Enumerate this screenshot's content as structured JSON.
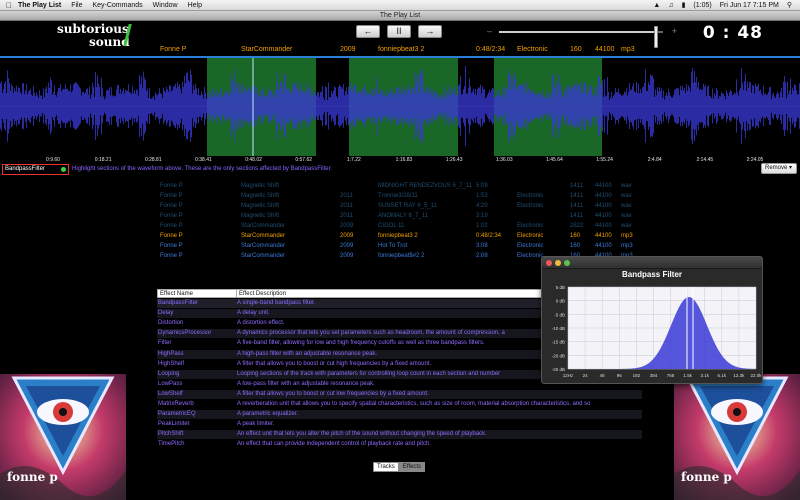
{
  "menubar": {
    "app_name": "The Play List",
    "items": [
      "File",
      "Key-Commands",
      "Window",
      "Help"
    ],
    "battery": "(1:05)",
    "datetime": "Fri Jun 17  7:15 PM"
  },
  "window": {
    "title": "The Play List"
  },
  "header": {
    "logo_top": "subtorious",
    "logo_bottom": "sound",
    "prev_symbol": "←",
    "pause_symbol": "II",
    "next_symbol": "→",
    "volume_level": 0.96,
    "timer": "0 : 48",
    "now_playing": {
      "artist": "Fonne P",
      "album": "StarCommander",
      "year": "2009",
      "title": "fonniepbeat3 2",
      "time": "0:48/2:34",
      "genre": "Electronic",
      "bpm": "160",
      "rate": "44100",
      "format": "mp3"
    }
  },
  "waveform": {
    "time_labels": [
      "0:9.60",
      "0:18.21",
      "0:28.81",
      "0:38.41",
      "0:48.02",
      "0:57.62",
      "1:7.22",
      "1:16.83",
      "1:26.43",
      "1:36.03",
      "1:45.64",
      "1:55.24",
      "2:4.84",
      "2:14.45",
      "2:24.05"
    ]
  },
  "filter": {
    "name": "BandpassFilter",
    "hint": "Highlight sections of the waveform above. These are the only sections affected by BandpassFilter.",
    "remove_label": "Remove ▾"
  },
  "tracks": [
    {
      "artist": "Fonne P",
      "album": "Magnetic Shift",
      "year": "",
      "title": "MIDNIGHT RENDEZVOUS 6_7_11",
      "time": "5:09",
      "genre": "",
      "bpm": "1411",
      "rate": "44100",
      "format": "wav",
      "color": "#1f4f73"
    },
    {
      "artist": "Fonne P",
      "album": "Magnetic Shift",
      "year": "2011",
      "title": "Tronnie3/28/11",
      "time": "1:53",
      "genre": "Electronic",
      "bpm": "1411",
      "rate": "44100",
      "format": "wav",
      "color": "#1f4f73"
    },
    {
      "artist": "Fonne P",
      "album": "Magnetic Shift",
      "year": "2011",
      "title": "SUNSET RAY 6_5_11",
      "time": "4:20",
      "genre": "Electronic",
      "bpm": "1411",
      "rate": "44100",
      "format": "wav",
      "color": "#1f4f73"
    },
    {
      "artist": "Fonne P",
      "album": "Magnetic Shift",
      "year": "2011",
      "title": "ANOMALY 6_7_11",
      "time": "3:19",
      "genre": "",
      "bpm": "1411",
      "rate": "44100",
      "format": "wav",
      "color": "#1f4f73"
    },
    {
      "artist": "Fonne P",
      "album": "StarCommander",
      "year": "2009",
      "title": "CIGOL 11",
      "time": "1:02",
      "genre": "Electronic",
      "bpm": "2822",
      "rate": "44100",
      "format": "wav",
      "color": "#1f4f73"
    },
    {
      "artist": "Fonne P",
      "album": "StarCommander",
      "year": "2009",
      "title": "fonniepbeat3 2",
      "time": "0:48/2:34",
      "genre": "Electronic",
      "bpm": "160",
      "rate": "44100",
      "format": "mp3",
      "color": "#f0a000"
    },
    {
      "artist": "Fonne P",
      "album": "StarCommander",
      "year": "2009",
      "title": "Hot To Trot",
      "time": "3:08",
      "genre": "Electronic",
      "bpm": "160",
      "rate": "44100",
      "format": "mp3",
      "color": "#3a7ad8"
    },
    {
      "artist": "Fonne P",
      "album": "StarCommander",
      "year": "2009",
      "title": "fonniepbeat$#2 2",
      "time": "2:08",
      "genre": "Electronic",
      "bpm": "160",
      "rate": "44100",
      "format": "mp3",
      "color": "#3a7ad8"
    }
  ],
  "effects": {
    "col_name": "Effect Name",
    "col_desc": "Effect Description",
    "rows": [
      {
        "name": "BandpassFilter",
        "desc": "A single-band bandpass filter."
      },
      {
        "name": "Delay",
        "desc": "A delay unit."
      },
      {
        "name": "Distortion",
        "desc": "A distortion effect."
      },
      {
        "name": "DynamicsProcessor",
        "desc": "A dynamics processor that lets you set parameters such as headroom, the amount of compression, a"
      },
      {
        "name": "Filter",
        "desc": "A five-band filter, allowing for low and high frequency cutoffs as well as three bandpass filters."
      },
      {
        "name": "HighPass",
        "desc": "A high-pass filter with an adjustable resonance peak."
      },
      {
        "name": "HighShelf",
        "desc": "A filter that allows you to boost or cut high frequencies by a fixed amount."
      },
      {
        "name": "Looping",
        "desc": "Looping sections of the track with parameters for controlling loop count in each section and number"
      },
      {
        "name": "LowPass",
        "desc": "A low-pass filter with an adjustable resonance peak."
      },
      {
        "name": "LowShelf",
        "desc": "A filter that allows you to boost or cut low frequencies by a fixed amount."
      },
      {
        "name": "MatrixReverb",
        "desc": "A reverberation unit that allows you to specify spatial characteristics, such as size of room, material absorption characteristics, and so"
      },
      {
        "name": "ParametricEQ",
        "desc": "A parametric equalizer."
      },
      {
        "name": "PeakLimiter",
        "desc": "A peak limiter."
      },
      {
        "name": "PitchShift",
        "desc": "An effect unit that lets you alter the pitch of the sound without changing the speed of playback."
      },
      {
        "name": "TimePitch",
        "desc": "An effect that can provide independent control of playback rate and pitch."
      }
    ]
  },
  "tabs": [
    "Tracks",
    "Effects"
  ],
  "art": {
    "label": "fonne p"
  },
  "bandpass": {
    "title": "Bandpass Filter",
    "db_labels": [
      "5 dB",
      "0 dB",
      "-5 dB",
      "-10 dB",
      "-15 dB",
      "-20 dB",
      "-25 dB"
    ],
    "freq_labels": [
      "12Hz",
      "24",
      "48",
      "96",
      "192",
      "384",
      "768",
      "1.5k",
      "3.1k",
      "6.1k",
      "12.3k",
      "22.0k"
    ]
  },
  "colors": {
    "accent_orange": "#f0a000",
    "waveform_blue": "#3a3ad8",
    "selection_green": "#1f7a2e",
    "effect_text": "#8f6cff"
  }
}
